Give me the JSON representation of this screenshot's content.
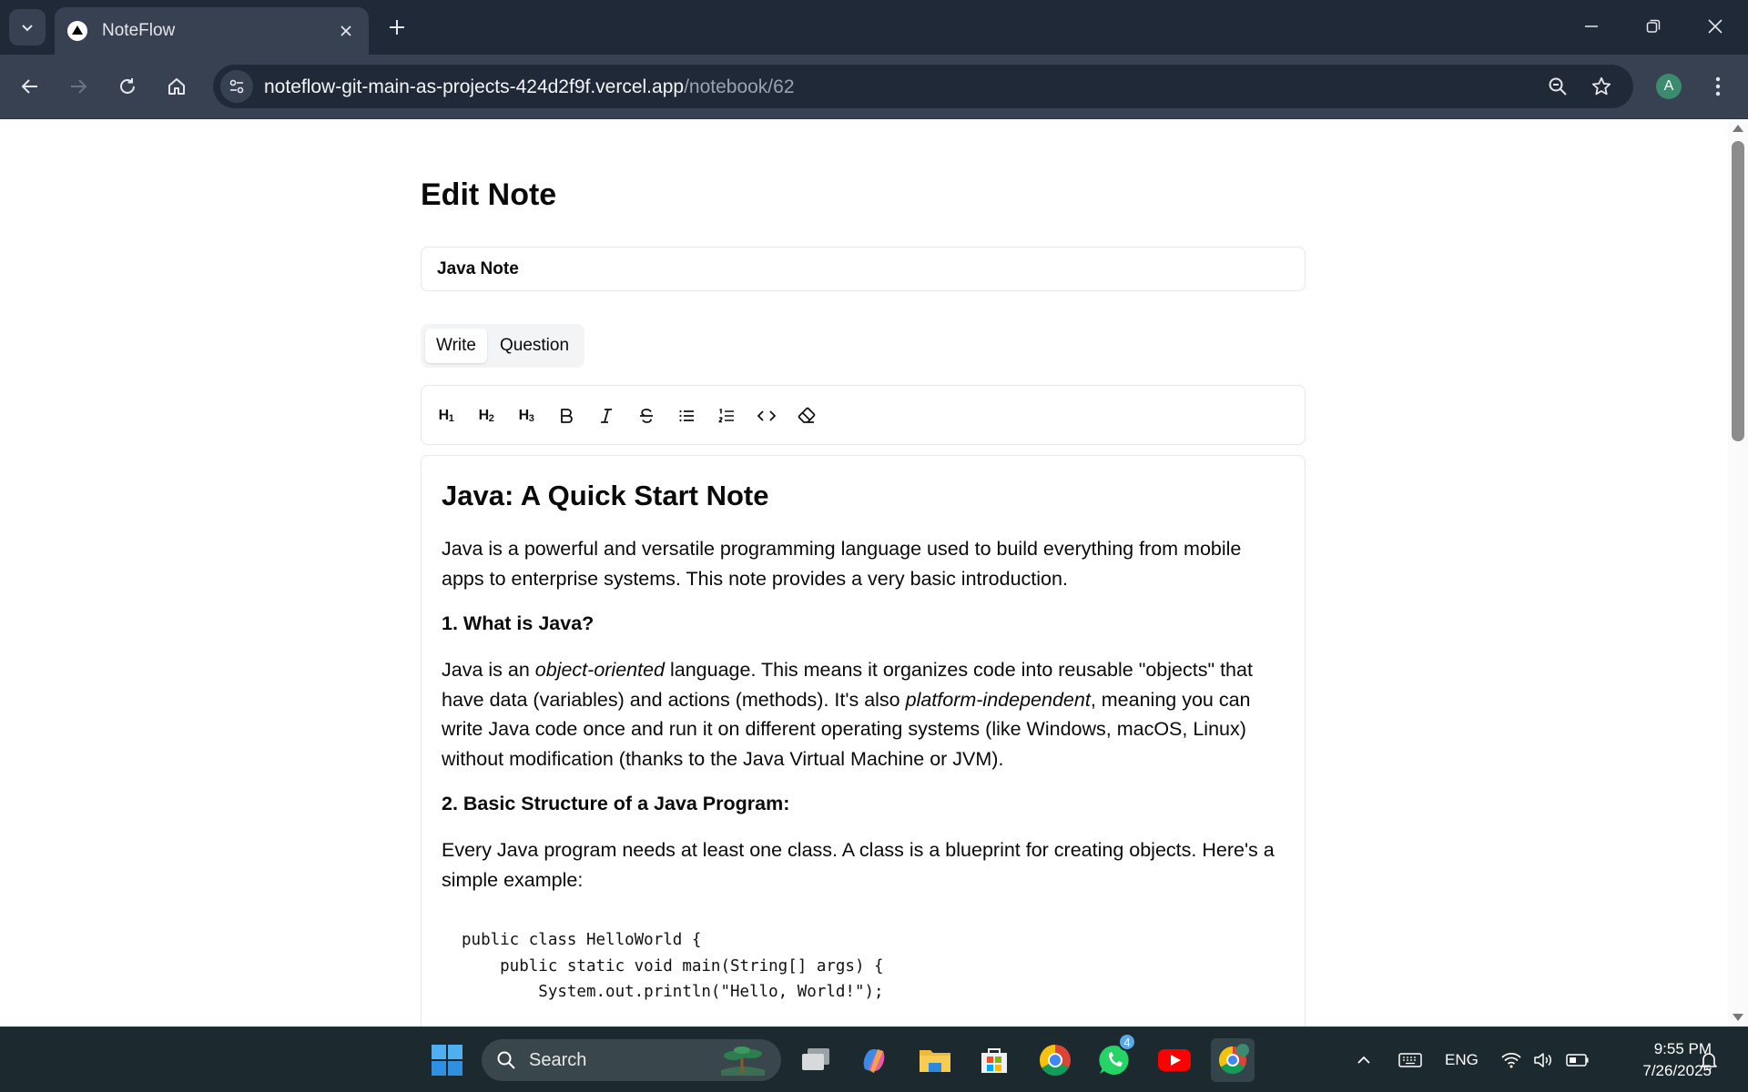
{
  "browser": {
    "tab_title": "NoteFlow",
    "url_host": "noteflow-git-main-as-projects-424d2f9f.vercel.app",
    "url_path": "/notebook/62",
    "profile_initial": "A"
  },
  "page": {
    "heading": "Edit Note",
    "note_title": "Java Note",
    "tabs": [
      {
        "label": "Write",
        "active": true
      },
      {
        "label": "Question",
        "active": false
      }
    ],
    "toolbar": {
      "h1": "H",
      "h1_sub": "1",
      "h2": "H",
      "h2_sub": "2",
      "h3": "H",
      "h3_sub": "3",
      "bold": "B",
      "italic": "I",
      "strike": "S"
    }
  },
  "document": {
    "title": "Java: A Quick Start Note",
    "intro": "Java is a powerful and versatile programming language used to build everything from mobile apps to enterprise systems. This note provides a very basic introduction.",
    "section1_heading": "1. What is Java?",
    "section1_part1": "Java is an ",
    "section1_em1": "object-oriented",
    "section1_part2": " language. This means it organizes code into reusable \"objects\" that have data (variables) and actions (methods). It's also ",
    "section1_em2": "platform-independent",
    "section1_part3": ", meaning you can write Java code once and run it on different operating systems (like Windows, macOS, Linux) without modification (thanks to the Java Virtual Machine or JVM).",
    "section2_heading": "2. Basic Structure of a Java Program:",
    "section2_text": "Every Java program needs at least one class. A class is a blueprint for creating objects. Here's a simple example:",
    "code": "public class HelloWorld {\n    public static void main(String[] args) {\n        System.out.println(\"Hello, World!\");"
  },
  "taskbar": {
    "search_label": "Search",
    "whatsapp_badge": "4",
    "language": "ENG",
    "time": "9:55 PM",
    "date": "7/26/2025"
  },
  "colors": {
    "tabbar_bg": "#1f2937",
    "toolbar_bg": "#374151",
    "taskbar_bg": "#1c2a2f",
    "avatar": "#3b8c6e"
  }
}
